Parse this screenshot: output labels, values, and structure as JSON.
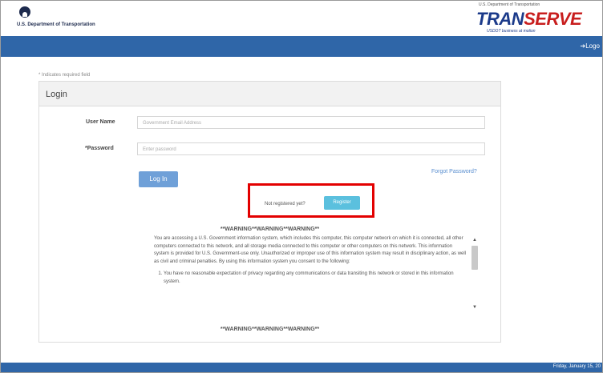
{
  "header": {
    "dot_label": "U.S. Department of Transportation",
    "transerve_top": "U.S. Department of Transportation",
    "logo_part1": "TRAN",
    "logo_part2": "SERVE",
    "logo_tagline": "USDOT business at motion"
  },
  "nav": {
    "logout": "Logo"
  },
  "required_note": "* Indicates required field",
  "panel": {
    "title": "Login"
  },
  "form": {
    "username_label": "User Name",
    "username_placeholder": "Government Email Address",
    "password_label": "*Password",
    "password_placeholder": "Enter password",
    "login_button": "Log In",
    "forgot_password": "Forgot Password?"
  },
  "register": {
    "prompt": "Not registered yet?",
    "button": "Register"
  },
  "warning": {
    "title_top": "**WARNING**WARNING**WARNING**",
    "paragraph": "You are accessing a U.S. Government information system, which includes this computer, this computer network on which it is connected, all other computers connected to this network, and all storage media connected to this computer or other computers on this network. This information system is provided for U.S. Government-use only. Unauthorized or improper use of this information system may result in disciplinary action, as well as civil and criminal penalties. By using this information system you consent to the following:",
    "item1": "You have no reasonable expectation of privacy regarding any communications or data transiting this network or stored in this information system.",
    "title_bottom": "**WARNING**WARNING**WARNING**"
  },
  "footer": {
    "date": "Friday, January 15, 20"
  }
}
